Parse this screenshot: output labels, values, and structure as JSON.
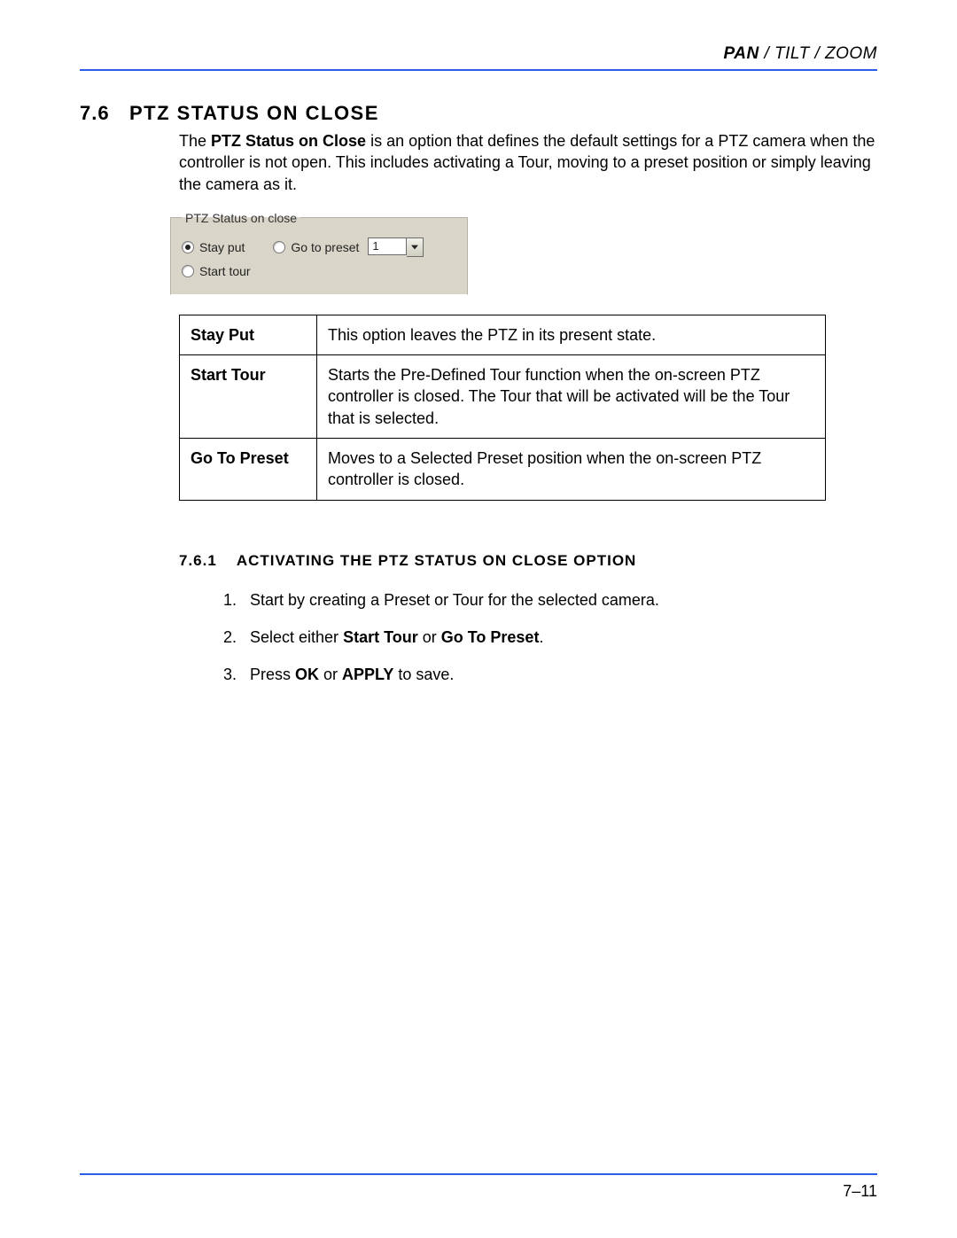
{
  "header": {
    "bold_part": "PAN",
    "rest_part": " / TILT / ZOOM"
  },
  "section": {
    "number": "7.6",
    "title": "PTZ STATUS ON CLOSE"
  },
  "intro": {
    "pre": "The ",
    "bold": "PTZ Status on Close",
    "post": " is an option that defines the default settings for a PTZ camera when the controller is not open. This includes activating a Tour, moving to a preset position or simply leaving the camera as it."
  },
  "fieldset": {
    "legend": "PTZ Status on close",
    "opt_stay": "Stay put",
    "opt_start": "Start tour",
    "opt_goto": "Go to preset",
    "combo_value": "1"
  },
  "table": {
    "rows": [
      {
        "k": "Stay Put",
        "v": "This option leaves the PTZ in its present state."
      },
      {
        "k": "Start Tour",
        "v": "Starts the Pre-Defined Tour function when the on-screen PTZ controller is closed. The Tour that will be activated will be the Tour that is selected."
      },
      {
        "k": "Go To Preset",
        "v": "Moves to a Selected Preset position when the on-screen PTZ controller is closed."
      }
    ]
  },
  "subsection": {
    "number": "7.6.1",
    "title": "ACTIVATING THE PTZ STATUS ON CLOSE OPTION"
  },
  "steps": {
    "s1": "Start by creating a Preset or Tour for the selected camera.",
    "s2_pre": "Select either ",
    "s2_b1": "Start Tour",
    "s2_mid": " or ",
    "s2_b2": "Go To Preset",
    "s2_post": ".",
    "s3_pre": "Press ",
    "s3_b1": "OK",
    "s3_mid": " or ",
    "s3_b2": "APPLY",
    "s3_post": " to save."
  },
  "footer": {
    "page": "7–11"
  }
}
